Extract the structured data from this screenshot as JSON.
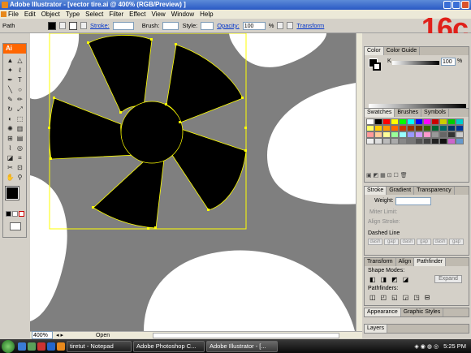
{
  "window": {
    "title": "Adobe Illustrator - [vector tire.ai @ 400% (RGB/Preview) ]"
  },
  "menu": [
    "File",
    "Edit",
    "Object",
    "Type",
    "Select",
    "Filter",
    "Effect",
    "View",
    "Window",
    "Help"
  ],
  "control": {
    "path_label": "Path",
    "stroke_label": "Stroke:",
    "brush_label": "Brush:",
    "style_label": "Style:",
    "opacity_label": "Opacity:",
    "opacity_value": "100",
    "opacity_unit": "%",
    "transform_label": "Transform"
  },
  "overlay_text": "16c",
  "toolbox": {
    "header": "Ai"
  },
  "canvas": {
    "zoom": "400%",
    "status": "Open"
  },
  "panels": {
    "color": {
      "tabs": [
        "Color",
        "Color Guide"
      ],
      "k_label": "K",
      "k_value": "100",
      "k_unit": "%"
    },
    "swatches": {
      "tabs": [
        "Swatches",
        "Brushes",
        "Symbols"
      ]
    },
    "stroke": {
      "tabs": [
        "Stroke",
        "Gradient",
        "Transparency"
      ],
      "weight_label": "Weight:",
      "miter_label": "Miter Limit:",
      "align_label": "Align Stroke:",
      "dashed_label": "Dashed Line",
      "dash_labels": [
        "dash",
        "gap",
        "dash",
        "gap",
        "dash",
        "gap"
      ]
    },
    "pathfinder": {
      "tabs": [
        "Transform",
        "Align",
        "Pathfinder"
      ],
      "shape_modes_label": "Shape Modes:",
      "expand_label": "Expand",
      "pathfinders_label": "Pathfinders:"
    },
    "appearance": {
      "tabs": [
        "Appearance",
        "Graphic Styles"
      ]
    },
    "layers": {
      "tabs": [
        "Layers"
      ]
    }
  },
  "taskbar": {
    "buttons": [
      "tiretut - Notepad",
      "Adobe Photoshop C...",
      "Adobe Illustrator - [..."
    ],
    "clock": "5:25 PM"
  },
  "colors": {
    "accent": "#ff6600",
    "selection": "#ffff00",
    "overlay_red": "#e0201a"
  }
}
